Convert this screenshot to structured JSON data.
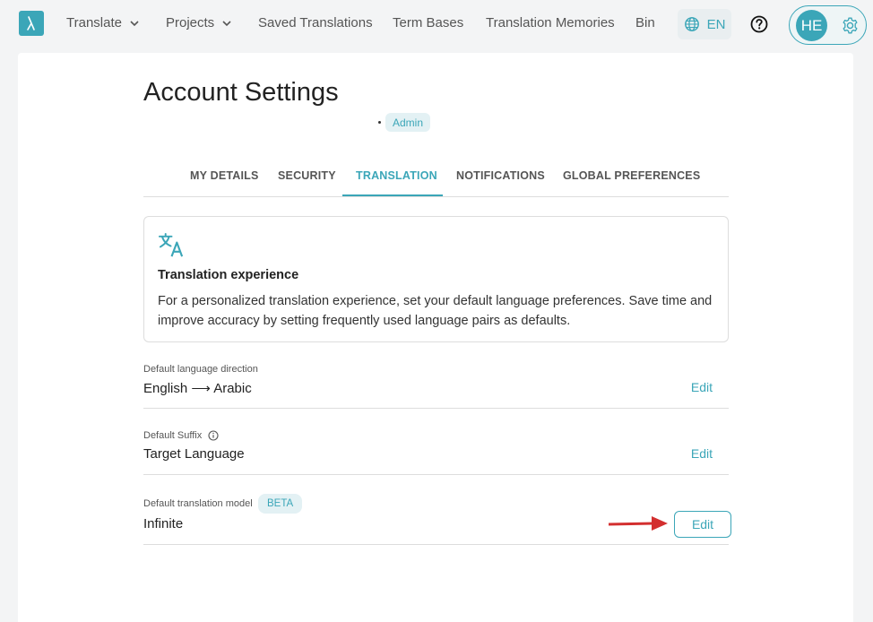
{
  "nav": {
    "items": [
      {
        "label": "Translate",
        "has_dropdown": true
      },
      {
        "label": "Projects",
        "has_dropdown": true
      },
      {
        "label": "Saved Translations"
      },
      {
        "label": "Term Bases"
      },
      {
        "label": "Translation Memories"
      },
      {
        "label": "Bin"
      }
    ],
    "language": "EN",
    "user_initials": "HE"
  },
  "page": {
    "title": "Account Settings",
    "role": "Admin"
  },
  "tabs": [
    {
      "label": "MY DETAILS"
    },
    {
      "label": "SECURITY"
    },
    {
      "label": "TRANSLATION",
      "active": true
    },
    {
      "label": "NOTIFICATIONS"
    },
    {
      "label": "GLOBAL PREFERENCES"
    }
  ],
  "info_box": {
    "icon": "translate-icon",
    "title": "Translation experience",
    "text": "For a personalized translation experience, set your default language preferences. Save time and improve accuracy by setting frequently used language pairs as defaults."
  },
  "settings": [
    {
      "label": "Default language direction",
      "value": "English ⟶ Arabic",
      "action": "Edit"
    },
    {
      "label": "Default Suffix",
      "value": "Target Language",
      "action": "Edit",
      "has_info_icon": true
    },
    {
      "label": "Default translation model",
      "badge": "BETA",
      "value": "Infinite",
      "action": "Edit"
    }
  ],
  "colors": {
    "accent": "#3ba6b8",
    "arrow": "#d32f2f"
  }
}
